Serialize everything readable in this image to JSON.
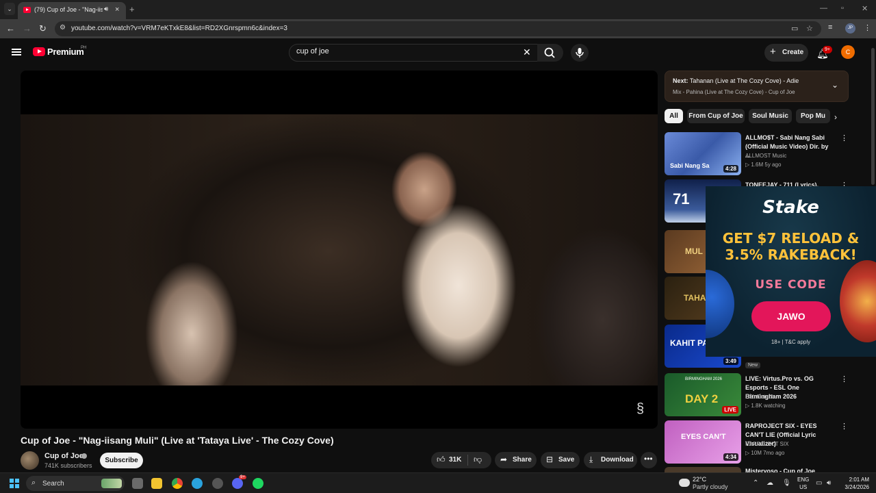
{
  "browser": {
    "tab_title": "(79) Cup of Joe - \"Nag-iisang",
    "url": "youtube.com/watch?v=VRM7eKTxkE8&list=RD2XGnrspmn6c&index=3",
    "profile_initials": "JP"
  },
  "header": {
    "logo_text": "Premium",
    "region": "PH",
    "search_value": "cup of joe",
    "create_label": "Create",
    "notif_badge": "9+",
    "avatar_initial": "C"
  },
  "video": {
    "title": "Cup of Joe - \"Nag-iisang Muli\" (Live at 'Tataya Live' - The Cozy Cove)",
    "channel": "Cup of Joe",
    "subscribers": "741K subscribers",
    "subscribe_label": "Subscribe",
    "likes": "31K",
    "share_label": "Share",
    "save_label": "Save",
    "download_label": "Download"
  },
  "up_next": {
    "prefix": "Next:",
    "title": "Tahanan (Live at The Cozy Cove) - Adie",
    "mix": "Mix - Pahina (Live at The Cozy Cove) - Cup of Joe"
  },
  "chips": [
    "All",
    "From Cup of Joe",
    "Soul Music",
    "Pop Mu"
  ],
  "recommendations": [
    {
      "title": "ALLMO$T - Sabi Nang Sabi (Official Music Video) Dir. by ...",
      "channel": "ALLMOST Music",
      "meta": "▷ 1.6M  5y ago",
      "duration": "4:28",
      "thumb_text": "Sabi Nang Sa"
    },
    {
      "title": "TONEEJAY - 711 (Lyrics),",
      "channel": "",
      "meta": "",
      "duration": "",
      "thumb_text": "71"
    },
    {
      "title": "",
      "channel": "",
      "meta": "",
      "duration": "",
      "thumb_text": "MUL"
    },
    {
      "title": "",
      "channel": "",
      "meta": "",
      "duration": "",
      "thumb_text": "TAHA"
    },
    {
      "title": "",
      "channel": "",
      "meta": "",
      "duration": "3:49",
      "thumb_text": "KAHIT PA"
    },
    {
      "title": "LIVE: Virtus.Pro vs. OG Esports - ESL One Birmingham 2026",
      "channel": "ESL Dota 2",
      "meta": "▷ 1.8K watching",
      "duration": "LIVE",
      "thumb_text": "DAY 2",
      "thumb_sub": "BIRMINGHAM 2026"
    },
    {
      "title": "RAPROJECT SIX - EYES CAN'T LIE (Official Lyric Visualizer)",
      "channel": "RAPROJECT SIX",
      "meta": "▷ 10M  7mo ago",
      "duration": "4:34",
      "thumb_text": "EYES CAN'T"
    },
    {
      "title": "Misteryoso - Cup of Joe",
      "channel": "",
      "meta": "",
      "duration": "",
      "thumb_text": ""
    }
  ],
  "new_badge": "New",
  "ad": {
    "brand": "Stake",
    "line1": "GET $7 RELOAD &",
    "line2": "3.5% RAKEBACK!",
    "code_label": "USE CODE",
    "code": "JAWO",
    "terms": "18+ | T&C apply"
  },
  "taskbar": {
    "search_label": "Search",
    "temp": "22°C",
    "weather": "Partly cloudy",
    "lang1": "ENG",
    "lang2": "US",
    "time": "2:01 AM",
    "date": "3/24/2026",
    "discord_badge": "9+"
  }
}
